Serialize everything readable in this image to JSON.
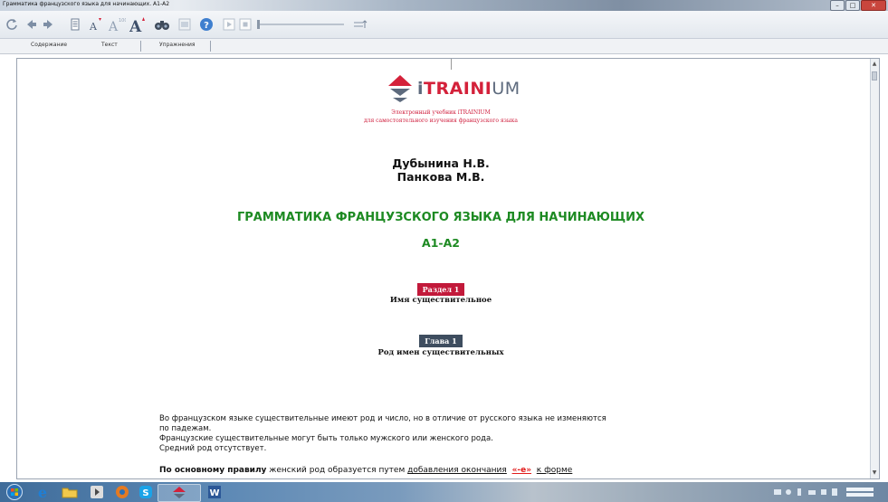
{
  "window": {
    "title": "Грамматика французского языка для начинающих. А1-А2"
  },
  "toolbar": {
    "buttons": [
      {
        "name": "refresh-icon",
        "glyph": "↻"
      },
      {
        "name": "back-arrow-icon",
        "glyph": "◀"
      },
      {
        "name": "forward-arrow-icon",
        "glyph": "▶"
      },
      {
        "name": "print-icon",
        "glyph": "▤"
      },
      {
        "name": "font-size-decrease-icon",
        "glyph": "A"
      },
      {
        "name": "font-size-reset-icon",
        "glyph": "A"
      },
      {
        "name": "font-size-increase-icon",
        "glyph": "A"
      },
      {
        "name": "search-binoculars-icon",
        "glyph": "⛯"
      },
      {
        "name": "notes-icon",
        "glyph": "▦"
      },
      {
        "name": "help-icon",
        "glyph": "?"
      }
    ]
  },
  "tabs": [
    {
      "label": "Содержание"
    },
    {
      "label": "Текст"
    },
    {
      "label": "Упражнения"
    }
  ],
  "doc": {
    "logo": {
      "part1": "i",
      "part2": "TRAINI",
      "part3": "UM"
    },
    "subtitle_line1": "Электронный учебник iTRAINIUM",
    "subtitle_line2": "для самостоятельного изучения французского языка",
    "author1": "Дубынина Н.В.",
    "author2": "Панкова М.В.",
    "book_title": "ГРАММАТИКА ФРАНЦУЗСКОГО ЯЗЫКА ДЛЯ НАЧИНАЮЩИХ",
    "level": "А1-А2",
    "section_badge": "Раздел 1",
    "section_name": "Имя существительное",
    "chapter_badge": "Глава 1",
    "chapter_name": "Род имен существительных",
    "para_line1": "Во французском языке существительные имеют род  и число, но в отличие от русского языка не изменяются",
    "para_line2": "по падежам.",
    "para_line3": "Французские существительные могут быть только мужского или женского рода.",
    "para_line4": "Средний род отсутствует.",
    "rule_bold": "По основному правилу",
    "rule_text1": " женский род образуется путем ",
    "rule_link": "добавления окончания",
    "rule_ending": "«-e»",
    "rule_text2": "к форме"
  },
  "colors": {
    "accent_red": "#d4213a",
    "title_green": "#1d8a22",
    "badge_section": "#c2193a",
    "badge_chapter": "#3e4d5f",
    "logo_gray": "#5d6a7d"
  }
}
